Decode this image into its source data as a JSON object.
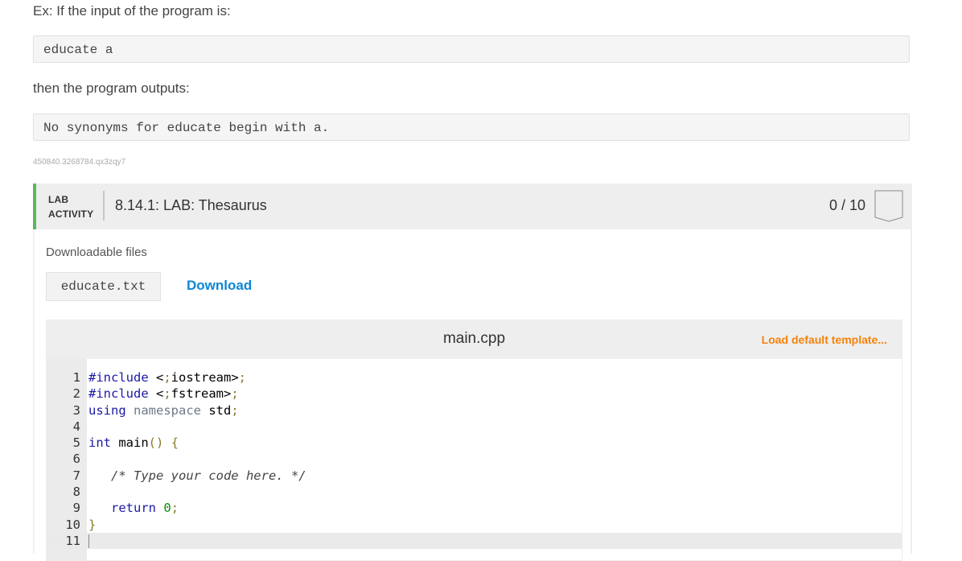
{
  "example": {
    "input_prompt": "Ex: If the input of the program is:",
    "input_value": "educate a",
    "output_prompt": "then the program outputs:",
    "output_value": "No synonyms for educate begin with a.",
    "reference_id": "450840.3268784.qx3zqy7"
  },
  "lab": {
    "type_line1": "LAB",
    "type_line2": "ACTIVITY",
    "title": "8.14.1: LAB: Thesaurus",
    "score": "0 / 10",
    "accent_color": "#5cb85c",
    "downloadable_label": "Downloadable files",
    "file_name": "educate.txt",
    "download_label": "Download",
    "editor": {
      "filename": "main.cpp",
      "load_template_label": "Load default template...",
      "lines": [
        {
          "n": "1",
          "text": "#include <iostream>"
        },
        {
          "n": "2",
          "text": "#include <fstream>"
        },
        {
          "n": "3",
          "text": "using namespace std;"
        },
        {
          "n": "4",
          "text": ""
        },
        {
          "n": "5",
          "text": "int main() {"
        },
        {
          "n": "6",
          "text": ""
        },
        {
          "n": "7",
          "text": "   /* Type your code here. */"
        },
        {
          "n": "8",
          "text": ""
        },
        {
          "n": "9",
          "text": "   return 0;"
        },
        {
          "n": "10",
          "text": "}"
        },
        {
          "n": "11",
          "text": ""
        }
      ]
    }
  }
}
